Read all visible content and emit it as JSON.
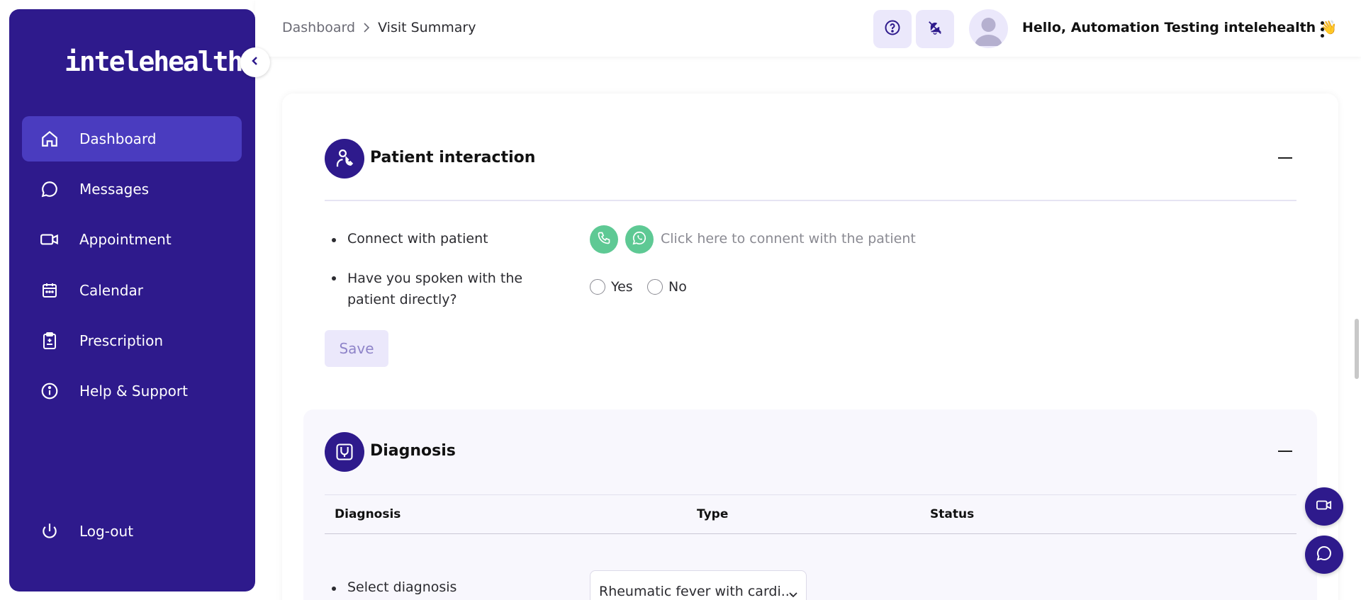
{
  "brand": {
    "logo_text": "intelehealth",
    "primary_color": "#2e1a8c",
    "accent_color": "#5ec994"
  },
  "sidebar": {
    "items": [
      {
        "label": "Dashboard",
        "icon": "home-icon",
        "active": true
      },
      {
        "label": "Messages",
        "icon": "chat-bubble-icon"
      },
      {
        "label": "Appointment",
        "icon": "video-camera-icon"
      },
      {
        "label": "Calendar",
        "icon": "calendar-icon"
      },
      {
        "label": "Prescription",
        "icon": "clipboard-icon"
      },
      {
        "label": "Help & Support",
        "icon": "info-icon"
      }
    ],
    "logout_label": "Log-out"
  },
  "header": {
    "breadcrumb": [
      "Dashboard",
      "Visit Summary"
    ],
    "greeting": "Hello, Automation Testing intelehealth",
    "greeting_emoji": "👋"
  },
  "patient_interaction": {
    "title": "Patient interaction",
    "connect_label": "Connect with patient",
    "connect_hint": "Click here to connent with the patient",
    "spoken_label": "Have you spoken with the patient directly?",
    "yes_label": "Yes",
    "no_label": "No",
    "save_label": "Save"
  },
  "diagnosis": {
    "title": "Diagnosis",
    "columns": [
      "Diagnosis",
      "Type",
      "Status"
    ],
    "select_label": "Select diagnosis",
    "select_value": "Rheumatic fever with cardi..."
  }
}
